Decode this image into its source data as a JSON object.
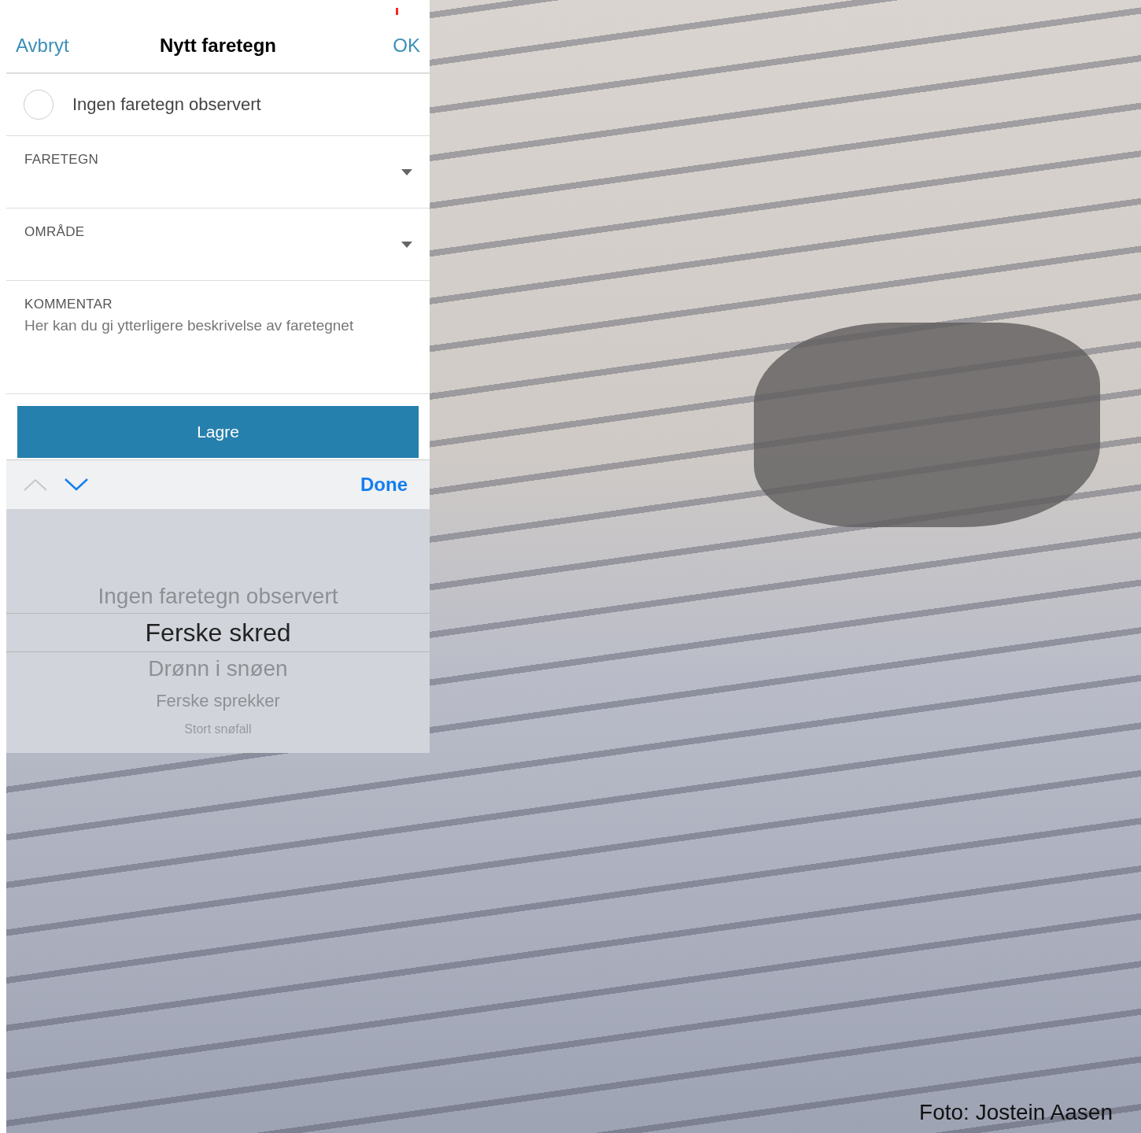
{
  "nav_bar": {
    "cancel": "Avbryt",
    "title": "Nytt faretegn",
    "ok": "OK"
  },
  "no_signs": {
    "label": "Ingen faretegn observert",
    "checked": false
  },
  "fields": [
    {
      "kind": "dropdown",
      "label": "FARETEGN"
    },
    {
      "kind": "dropdown",
      "label": "OMRÅDE"
    },
    {
      "kind": "textarea",
      "label": "KOMMENTAR",
      "placeholder": "Her kan du gi ytterligere beskrivelse av faretegnet"
    }
  ],
  "save_button": "Lagre",
  "picker_toolbar": {
    "previous_disabled": true,
    "next_disabled": false,
    "done": "Done"
  },
  "picker_items": [
    {
      "label": "Ingen faretegn observert",
      "selected": false
    },
    {
      "label": "Ferske skred",
      "selected": true
    },
    {
      "label": "Drønn i snøen",
      "selected": false
    },
    {
      "label": "Ferske sprekker",
      "selected": false
    },
    {
      "label": "Stort snøfall",
      "selected": false
    }
  ],
  "photo_credit": "Foto: Jostein Aasen"
}
